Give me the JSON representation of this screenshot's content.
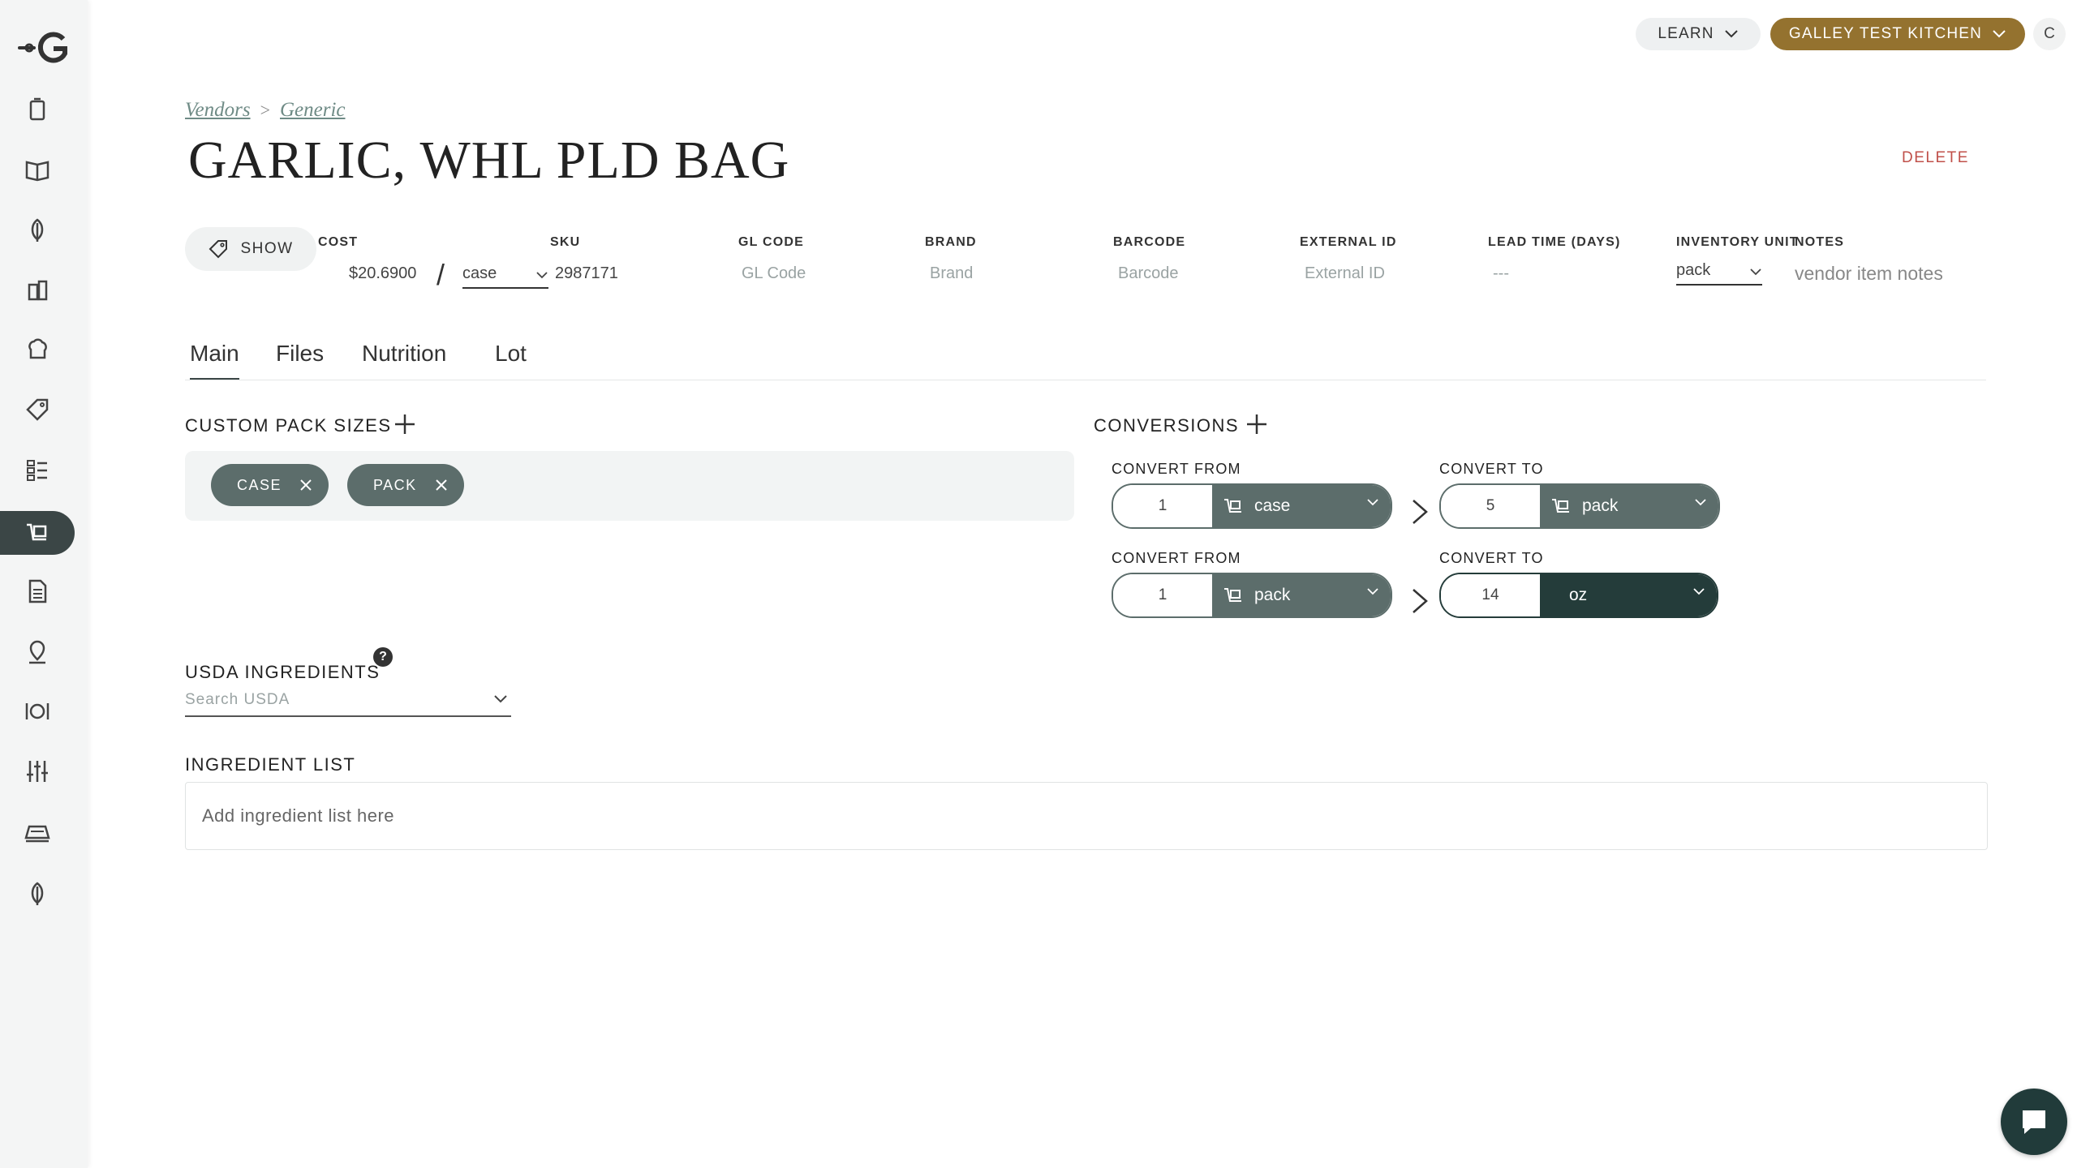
{
  "top": {
    "learn_label": "LEARN",
    "kitchen_label": "GALLEY TEST KITCHEN",
    "avatar_initial": "C"
  },
  "breadcrumb": {
    "items": [
      "Vendors",
      "Generic"
    ],
    "separator": ">"
  },
  "page": {
    "title": "GARLIC, WHL PLD BAG",
    "delete_label": "DELETE"
  },
  "fields": {
    "show_label": "SHOW",
    "cost": {
      "label": "COST",
      "value": "$20.6900",
      "unit": "case"
    },
    "sku": {
      "label": "SKU",
      "value": "2987171"
    },
    "gl_code": {
      "label": "GL CODE",
      "placeholder": "GL Code"
    },
    "brand": {
      "label": "BRAND",
      "placeholder": "Brand"
    },
    "barcode": {
      "label": "BARCODE",
      "placeholder": "Barcode"
    },
    "external_id": {
      "label": "EXTERNAL ID",
      "placeholder": "External ID"
    },
    "lead_time": {
      "label": "LEAD TIME (DAYS)",
      "placeholder": "---"
    },
    "inventory_unit": {
      "label": "INVENTORY UNIT",
      "value": "pack"
    },
    "notes": {
      "label": "NOTES",
      "placeholder": "vendor item notes"
    }
  },
  "tabs": [
    {
      "label": "Main",
      "active": true
    },
    {
      "label": "Files",
      "active": false
    },
    {
      "label": "Nutrition",
      "active": false
    },
    {
      "label": "Lot",
      "active": false
    }
  ],
  "custom_pack": {
    "title": "CUSTOM PACK SIZES",
    "chips": [
      "CASE",
      "PACK"
    ]
  },
  "conversions": {
    "title": "CONVERSIONS",
    "rows": [
      {
        "from_label": "CONVERT FROM",
        "from_qty": "1",
        "from_unit": "case",
        "to_label": "CONVERT TO",
        "to_qty": "5",
        "to_unit": "pack"
      },
      {
        "from_label": "CONVERT FROM",
        "from_qty": "1",
        "from_unit": "pack",
        "to_label": "CONVERT TO",
        "to_qty": "14",
        "to_unit": "oz"
      }
    ]
  },
  "usda": {
    "title": "USDA INGREDIENTS",
    "help": "?",
    "placeholder": "Search USDA"
  },
  "ingredients": {
    "title": "INGREDIENT LIST",
    "placeholder": "Add ingredient list here"
  },
  "colors": {
    "accent": "#94722f",
    "primary_dark": "#243c3a",
    "chip": "#5c6d6b",
    "danger": "#c0504a"
  }
}
